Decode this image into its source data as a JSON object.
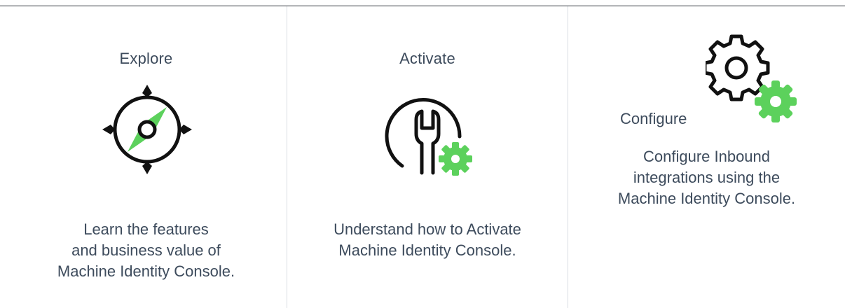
{
  "cards": [
    {
      "title": "Explore",
      "icon": "compass-icon",
      "desc_lines": [
        "Learn the features",
        "and business value of",
        "Machine Identity Console."
      ]
    },
    {
      "title": "Activate",
      "icon": "wrench-gear-icon",
      "desc_lines": [
        "Understand how to Activate",
        "Machine Identity Console."
      ]
    },
    {
      "title": "Configure",
      "icon": "gears-icon",
      "desc_lines": [
        "Configure Inbound",
        "integrations using the",
        "Machine Identity Console."
      ]
    }
  ],
  "colors": {
    "text": "#3d4b5c",
    "accent": "#5cd15c",
    "icon_stroke": "#111111",
    "divider": "#d9dde2",
    "top_rule": "#2a2f36"
  }
}
